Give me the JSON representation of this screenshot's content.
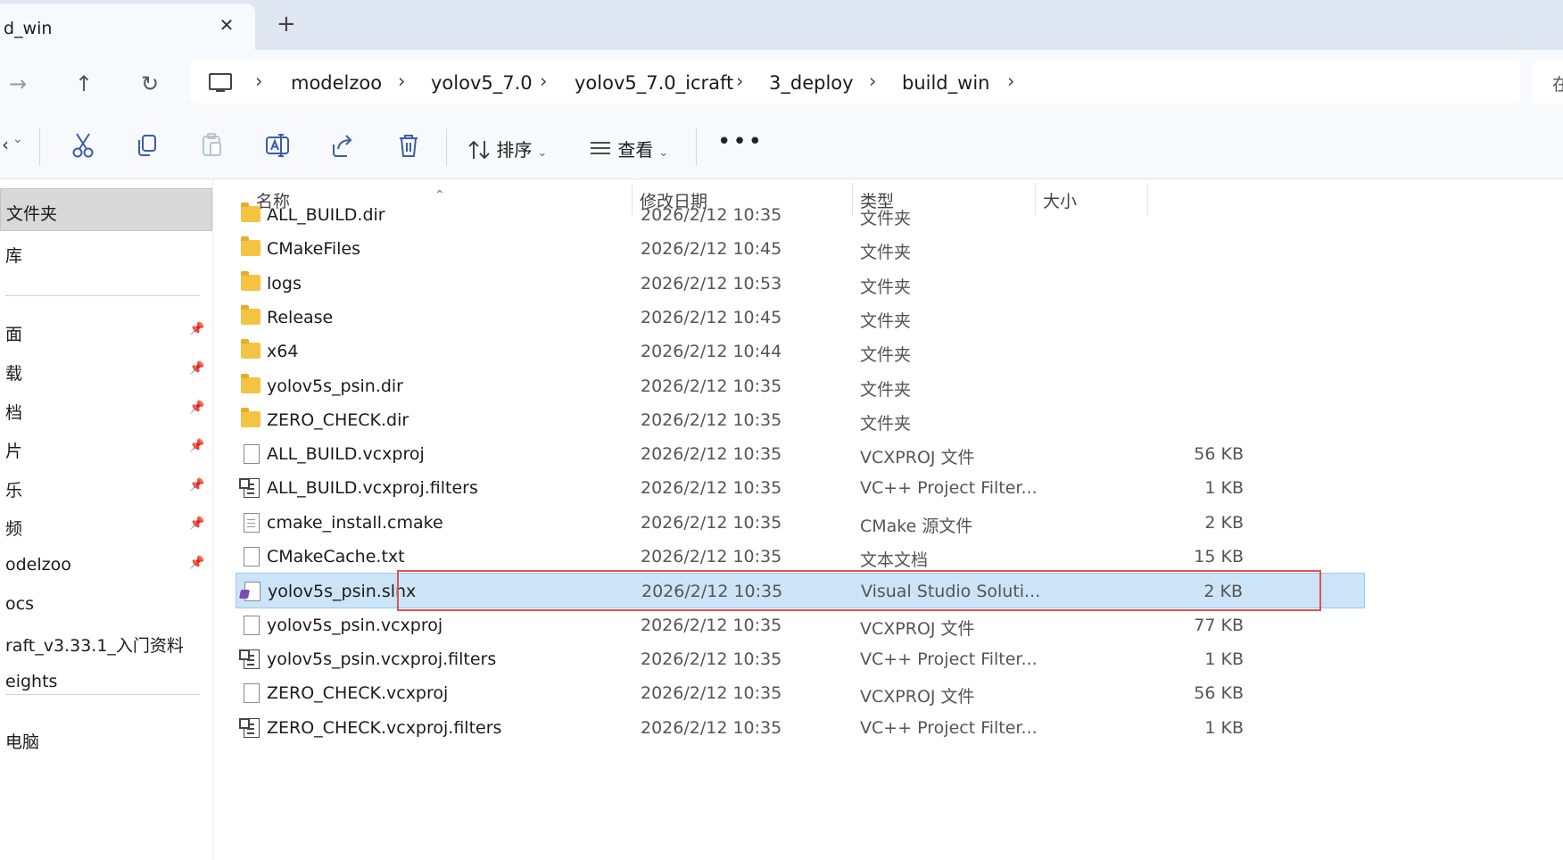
{
  "window": {
    "tab_title": "d_win",
    "tab_close": "✕",
    "new_tab": "+"
  },
  "nav": {
    "forward": "→",
    "up": "↑",
    "refresh": "↻"
  },
  "breadcrumb": [
    "modelzoo",
    "yolov5_7.0",
    "yolov5_7.0_icraft",
    "3_deploy",
    "build_win"
  ],
  "breadcrumb_sep": "›",
  "search": {
    "visible_text": "在"
  },
  "toolbar": {
    "new_partial": "‹",
    "sort_label": "排序",
    "view_label": "查看",
    "more_label": "•••",
    "caret": "⌄"
  },
  "sidebar": {
    "items": [
      {
        "label": "文件夹",
        "pinned": false,
        "selected": true
      },
      {
        "label": "库",
        "pinned": false
      },
      {
        "label": "面",
        "pinned": true
      },
      {
        "label": "载",
        "pinned": true
      },
      {
        "label": "档",
        "pinned": true
      },
      {
        "label": "片",
        "pinned": true
      },
      {
        "label": "乐",
        "pinned": true
      },
      {
        "label": "频",
        "pinned": true
      },
      {
        "label": "odelzoo",
        "pinned": true
      },
      {
        "label": "ocs",
        "pinned": false
      },
      {
        "label": "raft_v3.33.1_入门资料",
        "pinned": false
      },
      {
        "label": "eights",
        "pinned": false
      },
      {
        "label": "电脑",
        "pinned": false
      }
    ],
    "pin_icon": "📌"
  },
  "columns": {
    "name": "名称",
    "date": "修改日期",
    "type": "类型",
    "size": "大小",
    "sort_indicator": "⌃"
  },
  "files": [
    {
      "name": "ALL_BUILD.dir",
      "date": "2026/2/12 10:35",
      "type": "文件夹",
      "size": "",
      "icon": "folder-icon"
    },
    {
      "name": "CMakeFiles",
      "date": "2026/2/12 10:45",
      "type": "文件夹",
      "size": "",
      "icon": "folder-icon"
    },
    {
      "name": "logs",
      "date": "2026/2/12 10:53",
      "type": "文件夹",
      "size": "",
      "icon": "folder-icon"
    },
    {
      "name": "Release",
      "date": "2026/2/12 10:45",
      "type": "文件夹",
      "size": "",
      "icon": "folder-icon"
    },
    {
      "name": "x64",
      "date": "2026/2/12 10:44",
      "type": "文件夹",
      "size": "",
      "icon": "folder-icon"
    },
    {
      "name": "yolov5s_psin.dir",
      "date": "2026/2/12 10:35",
      "type": "文件夹",
      "size": "",
      "icon": "folder-icon"
    },
    {
      "name": "ZERO_CHECK.dir",
      "date": "2026/2/12 10:35",
      "type": "文件夹",
      "size": "",
      "icon": "folder-icon"
    },
    {
      "name": "ALL_BUILD.vcxproj",
      "date": "2026/2/12 10:35",
      "type": "VCXPROJ 文件",
      "size": "56 KB",
      "icon": "file-icon"
    },
    {
      "name": "ALL_BUILD.vcxproj.filters",
      "date": "2026/2/12 10:35",
      "type": "VC++ Project Filter...",
      "size": "1 KB",
      "icon": "filters-file-icon"
    },
    {
      "name": "cmake_install.cmake",
      "date": "2026/2/12 10:35",
      "type": "CMake 源文件",
      "size": "2 KB",
      "icon": "text-file-icon"
    },
    {
      "name": "CMakeCache.txt",
      "date": "2026/2/12 10:35",
      "type": "文本文档",
      "size": "15 KB",
      "icon": "file-icon"
    },
    {
      "name": "yolov5s_psin.slnx",
      "date": "2026/2/12 10:35",
      "type": "Visual Studio Soluti...",
      "size": "2 KB",
      "icon": "solution-file-icon",
      "selected": true
    },
    {
      "name": "yolov5s_psin.vcxproj",
      "date": "2026/2/12 10:35",
      "type": "VCXPROJ 文件",
      "size": "77 KB",
      "icon": "file-icon"
    },
    {
      "name": "yolov5s_psin.vcxproj.filters",
      "date": "2026/2/12 10:35",
      "type": "VC++ Project Filter...",
      "size": "1 KB",
      "icon": "filters-file-icon"
    },
    {
      "name": "ZERO_CHECK.vcxproj",
      "date": "2026/2/12 10:35",
      "type": "VCXPROJ 文件",
      "size": "56 KB",
      "icon": "file-icon"
    },
    {
      "name": "ZERO_CHECK.vcxproj.filters",
      "date": "2026/2/12 10:35",
      "type": "VC++ Project Filter...",
      "size": "1 KB",
      "icon": "filters-file-icon"
    }
  ],
  "colors": {
    "accent": "#3a5da8",
    "selection_bg": "#cce4f7",
    "selection_border": "#99c9ef",
    "highlight_box": "#e05151",
    "folder": "#f5c342"
  }
}
